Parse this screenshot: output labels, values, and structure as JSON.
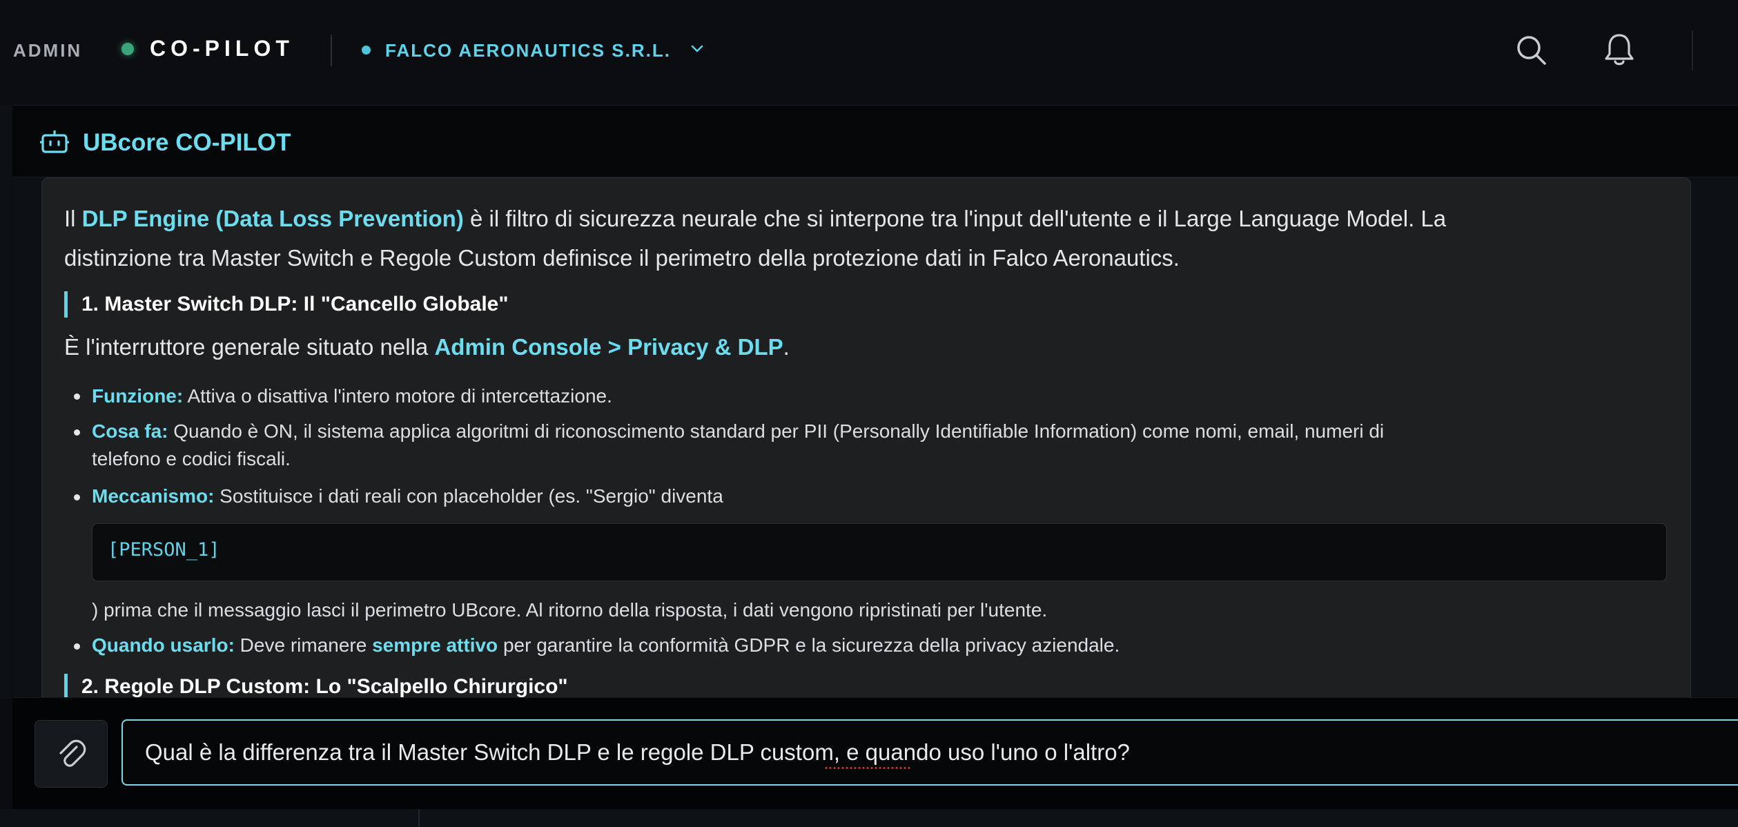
{
  "topbar": {
    "admin_label": "ADMIN",
    "brand": "CO-PILOT",
    "org_name": "FALCO AERONAUTICS S.R.L.",
    "status_color": "#3aa57a",
    "icons": [
      "search-icon",
      "bell-icon",
      "chevron-down-icon"
    ]
  },
  "panel": {
    "title": "UBcore CO-PILOT",
    "icon": "robot-icon"
  },
  "message": {
    "intro": {
      "p1": "Il ",
      "p1_hl": "DLP Engine (Data Loss Prevention)",
      "p1_rest": " è il filtro di sicurezza neurale che si interpone tra l'input dell'utente e il Large Language Model. La",
      "line2": "distinzione tra Master Switch e Regole Custom definisce il perimetro della protezione dati in Falco Aeronautics."
    },
    "section1": {
      "heading": "1. Master Switch DLP: Il \"Cancello Globale\"",
      "lead": "È l'interruttore generale situato nella ",
      "lead_hl": "Admin Console > Privacy & DLP",
      "lead_end": ".",
      "b1_label": "Funzione:",
      "b1_text": " Attiva o disattiva l'intero motore di intercettazione.",
      "b2_label": "Cosa fa:",
      "b2_text": " Quando è ON, il sistema applica algoritmi di riconoscimento standard per PII (Personally Identifiable Information) come nomi, email, numeri di",
      "b2_line2": "telefono e codici fiscali.",
      "b3_label": "Meccanismo:",
      "b3_text": " Sostituisce i dati reali con placeholder (es. \"Sergio\" diventa",
      "code": "[PERSON_1]",
      "b3_after": ") prima che il messaggio lasci il perimetro UBcore. Al ritorno della risposta, i dati vengono ripristinati per l'utente.",
      "b4_label": "Quando usarlo:",
      "b4_text1": " Deve rimanere ",
      "b4_hl": "sempre attivo",
      "b4_text2": " per garantire la conformità GDPR e la sicurezza della privacy aziendale."
    },
    "section2": {
      "heading": "2. Regole DLP Custom: Lo \"Scalpello Chirurgico\""
    }
  },
  "composer": {
    "attach_icon": "paperclip-icon",
    "input_value": "Qual è la differenza tra il Master Switch DLP e le regole DLP custom, e quando uso l'uno o l'altro?"
  },
  "colors": {
    "accent": "#6cdcef",
    "background": "#0a0c0f",
    "bubble": "#1e1f21"
  }
}
